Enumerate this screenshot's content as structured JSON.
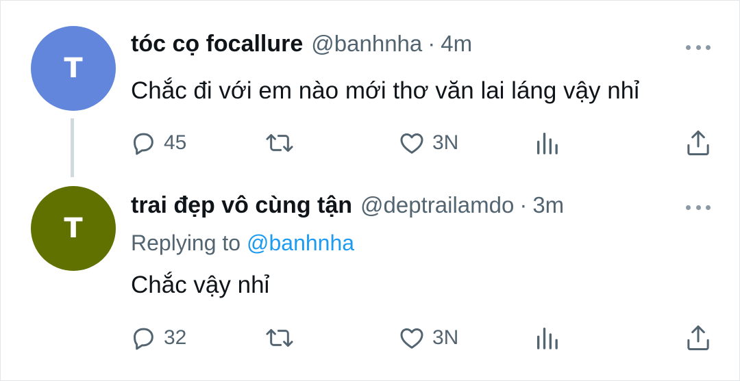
{
  "colors": {
    "avatar1": "#6286dc",
    "avatar2": "#617100",
    "link": "#1d9bf0",
    "muted": "#536471"
  },
  "tweets": [
    {
      "avatar_initial": "T",
      "name": "tóc cọ focallure",
      "handle": "@banhnha",
      "separator": "·",
      "time": "4m",
      "text": "Chắc đi với em nào mới thơ văn lai láng vậy nhỉ",
      "stats": {
        "replies": "45",
        "likes": "3N"
      }
    },
    {
      "avatar_initial": "T",
      "name": "trai đẹp vô cùng tận",
      "handle": "@deptrailamdo",
      "separator": "·",
      "time": "3m",
      "replying_prefix": "Replying to",
      "replying_to": "@banhnha",
      "text": "Chắc vậy nhỉ",
      "stats": {
        "replies": "32",
        "likes": "3N"
      }
    }
  ],
  "icons": [
    "reply-icon",
    "retweet-icon",
    "like-icon",
    "views-icon",
    "share-icon",
    "more-icon"
  ]
}
